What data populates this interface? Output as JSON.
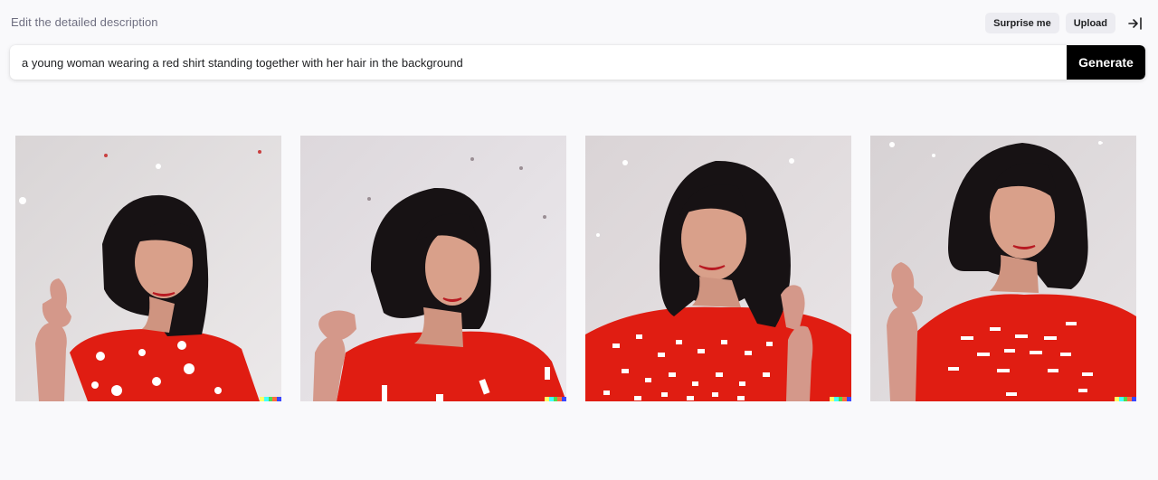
{
  "header": {
    "label": "Edit the detailed description",
    "surprise_label": "Surprise me",
    "upload_label": "Upload",
    "collapse_icon": "collapse-right-icon"
  },
  "prompt": {
    "value": "a young woman wearing a red shirt standing together with her hair in the background",
    "generate_label": "Generate"
  },
  "images": [
    {
      "alt": "Woman with dark bob haircut in red shirt with white spots, eyes closed, hand raised to the left"
    },
    {
      "alt": "Woman with dark shoulder-length hair in red t-shirt looking down, hand near shoulder"
    },
    {
      "alt": "Woman with dark hair in patterned red top smiling with eyes closed"
    },
    {
      "alt": "Woman with dark bob in red t-shirt looking down, hand raised to the left"
    }
  ],
  "colors": {
    "accent": "#000000",
    "shirt": "#e01d12",
    "hair": "#171214",
    "background": "#f9f9fb",
    "signature": [
      "#ffff66",
      "#42ffff",
      "#51da4c",
      "#ff6e3c",
      "#3c46ff"
    ]
  }
}
